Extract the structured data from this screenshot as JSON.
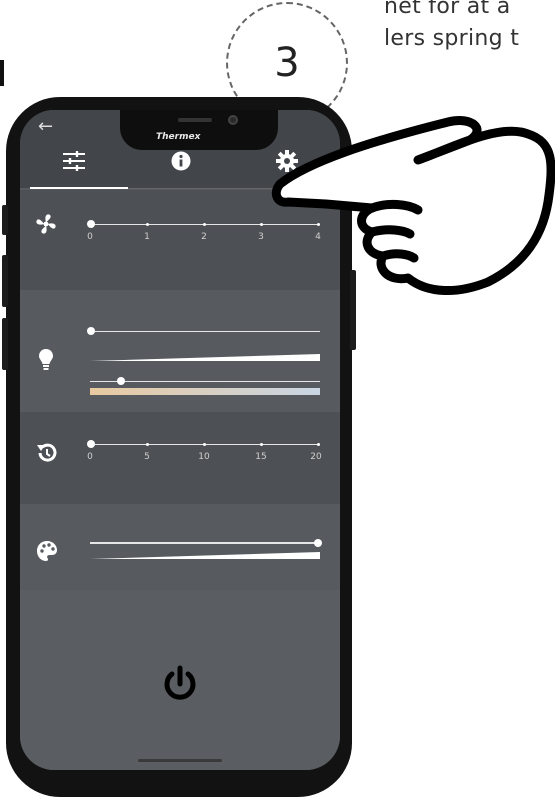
{
  "document": {
    "line1": "net for at å",
    "line2": "lers spring t"
  },
  "step": {
    "number": "3"
  },
  "app": {
    "brand": "Thermex",
    "back_icon": "arrow-left-icon",
    "tabs": [
      {
        "name": "controls",
        "icon": "sliders-icon",
        "active": true
      },
      {
        "name": "info",
        "icon": "info-icon",
        "active": false
      },
      {
        "name": "settings",
        "icon": "gear-icon",
        "active": false
      }
    ],
    "fan": {
      "icon": "fan-icon",
      "ticks": [
        "0",
        "1",
        "2",
        "3",
        "4"
      ],
      "value": 0
    },
    "light": {
      "icon": "bulb-icon",
      "brightness": 0,
      "temperature": 0.15
    },
    "timer": {
      "icon": "timer-icon",
      "ticks": [
        "0",
        "5",
        "10",
        "15",
        "20"
      ],
      "value": 0
    },
    "color": {
      "icon": "palette-icon",
      "value": 1
    },
    "power": {
      "icon": "power-icon"
    },
    "colors": {
      "accent": "#ffffff",
      "panel_dark": "#4d5155",
      "panel_light": "#575b5f",
      "warm": "#e8c9a0",
      "cool": "#c9d6e4"
    }
  }
}
